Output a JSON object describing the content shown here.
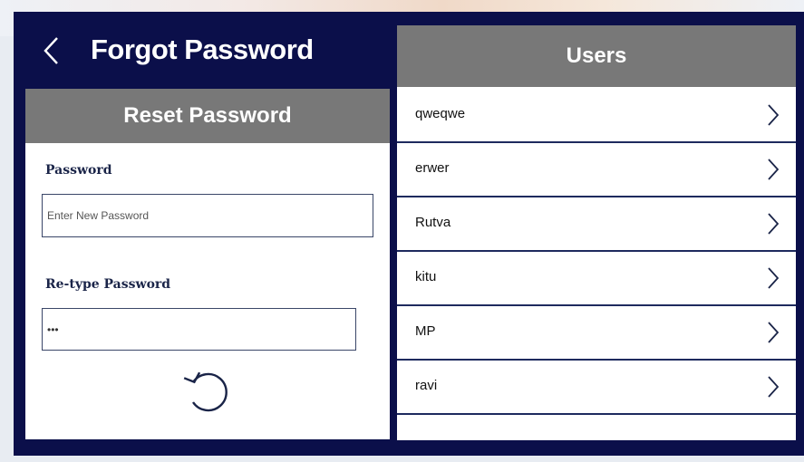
{
  "header": {
    "title": "Forgot Password"
  },
  "reset": {
    "title": "Reset Password",
    "password_label": "Password",
    "password_placeholder": "Enter New Password",
    "password_value": "",
    "retype_label": "Re-type Password",
    "retype_value": "•••"
  },
  "users": {
    "title": "Users",
    "items": [
      {
        "name": "qweqwe"
      },
      {
        "name": "erwer"
      },
      {
        "name": "Rutva"
      },
      {
        "name": "kitu"
      },
      {
        "name": "MP"
      },
      {
        "name": "ravi"
      }
    ]
  },
  "colors": {
    "navy": "#0b0f4a",
    "header_gray": "#787878",
    "row_divider": "#1e2a5e"
  },
  "icons": {
    "back": "chevron-left-icon",
    "reset": "undo-icon",
    "row": "chevron-right-icon"
  }
}
